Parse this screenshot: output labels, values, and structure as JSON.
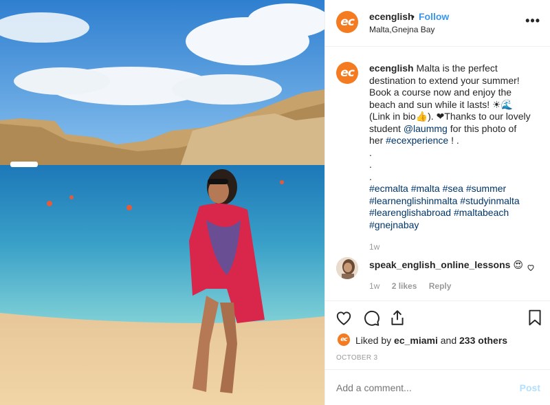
{
  "post": {
    "username": "ecenglish",
    "follow_separator": "•",
    "follow_label": "Follow",
    "location": "Malta,Gnejna Bay",
    "more_label": "•••",
    "logo_text": "ec"
  },
  "caption": {
    "username": "ecenglish",
    "line1": "Malta is the perfect",
    "line2": "destination to extend your summer!",
    "line3": "Book a course now and enjoy the",
    "line4": "beach and sun while it lasts! ☀🌊",
    "line5": "(Link in bio👍). ❤Thanks to our lovely",
    "line6_pre": "student ",
    "mention": "@laummg",
    "line6_post": " for this photo of",
    "line7_pre": "her ",
    "hashtag_inline": "#ecexperience",
    "line7_post": " ! .",
    "dot1": ".",
    "dot2": ".",
    "dot3": ".",
    "tags_line1": "#ecmalta #malta #sea #summer",
    "tags_line2": "#learnenglishinmalta #studyinmalta",
    "tags_line3": "#learenglishabroad #maltabeach",
    "tags_line4": "#gnejnabay",
    "time": "1w"
  },
  "comment": {
    "username": "speak_english_online_lessons",
    "emoji": "😍",
    "time": "1w",
    "likes": "2 likes",
    "reply": "Reply"
  },
  "likes": {
    "prefix": "Liked by ",
    "user": "ec_miami",
    "middle": " and ",
    "others": "233 others"
  },
  "date": "OCTOBER 3",
  "add_comment": {
    "placeholder": "Add a comment...",
    "post_label": "Post"
  },
  "colors": {
    "brand": "#f47b20",
    "link": "#3897f0",
    "hashtag": "#003569"
  }
}
